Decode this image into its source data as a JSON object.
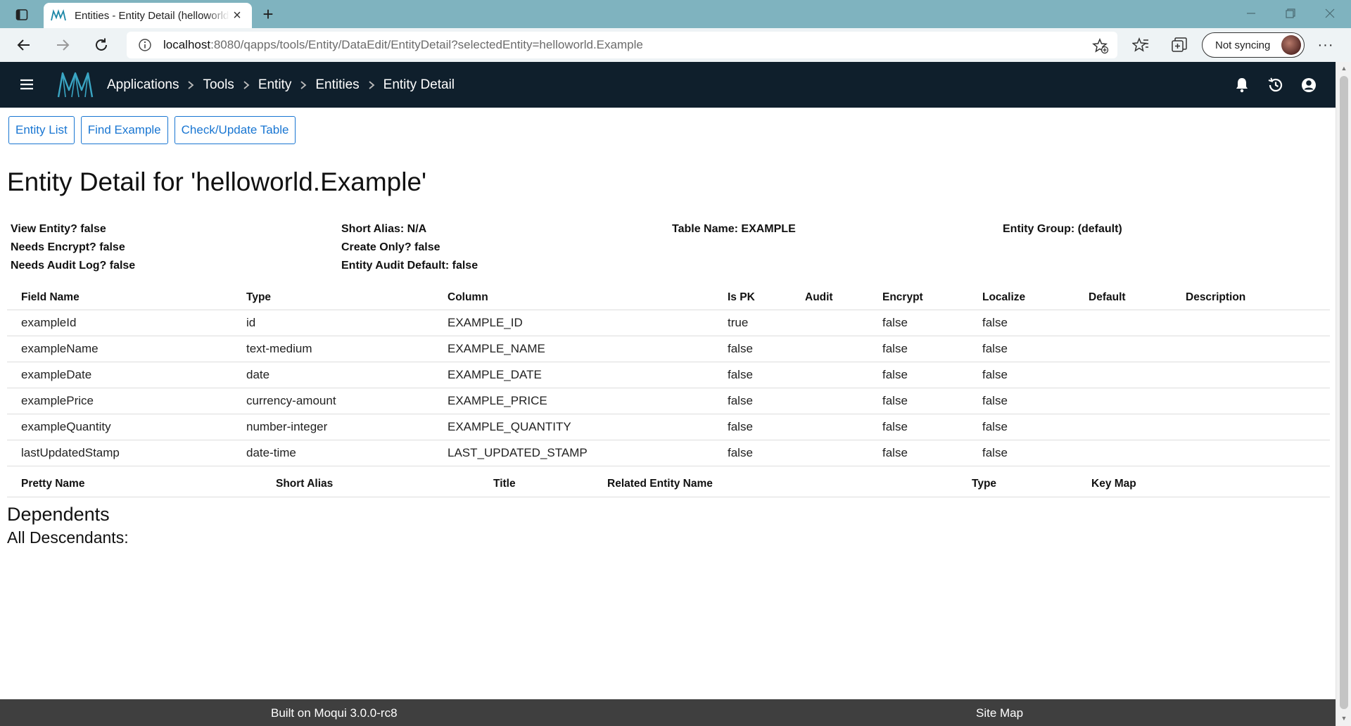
{
  "browser": {
    "tab_title": "Entities - Entity Detail (helloworld.Example)",
    "url_host": "localhost",
    "url_rest": ":8080/qapps/tools/Entity/DataEdit/EntityDetail?selectedEntity=helloworld.Example",
    "sync_label": "Not syncing",
    "more_label": "···"
  },
  "header": {
    "breadcrumbs": [
      "Applications",
      "Tools",
      "Entity",
      "Entities",
      "Entity Detail"
    ]
  },
  "buttons": {
    "entity_list": "Entity List",
    "find_example": "Find Example",
    "check_update": "Check/Update Table"
  },
  "page_title": "Entity Detail for 'helloworld.Example'",
  "summary": {
    "view_entity": "View Entity? false",
    "short_alias": "Short Alias: N/A",
    "table_name": "Table Name: EXAMPLE",
    "entity_group": "Entity Group: (default)",
    "needs_encrypt": "Needs Encrypt? false",
    "create_only": "Create Only? false",
    "needs_audit": "Needs Audit Log? false",
    "audit_default": "Entity Audit Default: false"
  },
  "fields_table": {
    "headers": [
      "Field Name",
      "Type",
      "Column",
      "Is PK",
      "Audit",
      "Encrypt",
      "Localize",
      "Default",
      "Description"
    ],
    "rows": [
      [
        "exampleId",
        "id",
        "EXAMPLE_ID",
        "true",
        "",
        "false",
        "false",
        "",
        ""
      ],
      [
        "exampleName",
        "text-medium",
        "EXAMPLE_NAME",
        "false",
        "",
        "false",
        "false",
        "",
        ""
      ],
      [
        "exampleDate",
        "date",
        "EXAMPLE_DATE",
        "false",
        "",
        "false",
        "false",
        "",
        ""
      ],
      [
        "examplePrice",
        "currency-amount",
        "EXAMPLE_PRICE",
        "false",
        "",
        "false",
        "false",
        "",
        ""
      ],
      [
        "exampleQuantity",
        "number-integer",
        "EXAMPLE_QUANTITY",
        "false",
        "",
        "false",
        "false",
        "",
        ""
      ],
      [
        "lastUpdatedStamp",
        "date-time",
        "LAST_UPDATED_STAMP",
        "false",
        "",
        "false",
        "false",
        "",
        ""
      ]
    ]
  },
  "relationships_table": {
    "headers": [
      "Pretty Name",
      "Short Alias",
      "Title",
      "Related Entity Name",
      "Type",
      "Key Map"
    ]
  },
  "dependents_title": "Dependents",
  "descendants_label": "All Descendants:",
  "footer": {
    "built_on": "Built on Moqui 3.0.0-rc8",
    "site_map": "Site Map"
  }
}
